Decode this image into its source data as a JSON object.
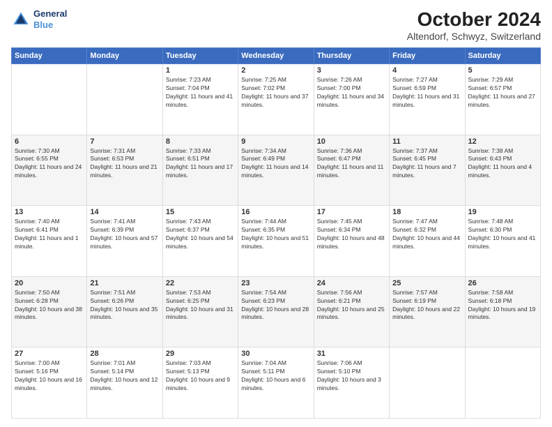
{
  "logo": {
    "line1": "General",
    "line2": "Blue"
  },
  "title": "October 2024",
  "subtitle": "Altendorf, Schwyz, Switzerland",
  "weekdays": [
    "Sunday",
    "Monday",
    "Tuesday",
    "Wednesday",
    "Thursday",
    "Friday",
    "Saturday"
  ],
  "weeks": [
    [
      {
        "day": "",
        "info": ""
      },
      {
        "day": "",
        "info": ""
      },
      {
        "day": "1",
        "info": "Sunrise: 7:23 AM\nSunset: 7:04 PM\nDaylight: 11 hours and 41 minutes."
      },
      {
        "day": "2",
        "info": "Sunrise: 7:25 AM\nSunset: 7:02 PM\nDaylight: 11 hours and 37 minutes."
      },
      {
        "day": "3",
        "info": "Sunrise: 7:26 AM\nSunset: 7:00 PM\nDaylight: 11 hours and 34 minutes."
      },
      {
        "day": "4",
        "info": "Sunrise: 7:27 AM\nSunset: 6:59 PM\nDaylight: 11 hours and 31 minutes."
      },
      {
        "day": "5",
        "info": "Sunrise: 7:29 AM\nSunset: 6:57 PM\nDaylight: 11 hours and 27 minutes."
      }
    ],
    [
      {
        "day": "6",
        "info": "Sunrise: 7:30 AM\nSunset: 6:55 PM\nDaylight: 11 hours and 24 minutes."
      },
      {
        "day": "7",
        "info": "Sunrise: 7:31 AM\nSunset: 6:53 PM\nDaylight: 11 hours and 21 minutes."
      },
      {
        "day": "8",
        "info": "Sunrise: 7:33 AM\nSunset: 6:51 PM\nDaylight: 11 hours and 17 minutes."
      },
      {
        "day": "9",
        "info": "Sunrise: 7:34 AM\nSunset: 6:49 PM\nDaylight: 11 hours and 14 minutes."
      },
      {
        "day": "10",
        "info": "Sunrise: 7:36 AM\nSunset: 6:47 PM\nDaylight: 11 hours and 11 minutes."
      },
      {
        "day": "11",
        "info": "Sunrise: 7:37 AM\nSunset: 6:45 PM\nDaylight: 11 hours and 7 minutes."
      },
      {
        "day": "12",
        "info": "Sunrise: 7:38 AM\nSunset: 6:43 PM\nDaylight: 11 hours and 4 minutes."
      }
    ],
    [
      {
        "day": "13",
        "info": "Sunrise: 7:40 AM\nSunset: 6:41 PM\nDaylight: 11 hours and 1 minute."
      },
      {
        "day": "14",
        "info": "Sunrise: 7:41 AM\nSunset: 6:39 PM\nDaylight: 10 hours and 57 minutes."
      },
      {
        "day": "15",
        "info": "Sunrise: 7:43 AM\nSunset: 6:37 PM\nDaylight: 10 hours and 54 minutes."
      },
      {
        "day": "16",
        "info": "Sunrise: 7:44 AM\nSunset: 6:35 PM\nDaylight: 10 hours and 51 minutes."
      },
      {
        "day": "17",
        "info": "Sunrise: 7:45 AM\nSunset: 6:34 PM\nDaylight: 10 hours and 48 minutes."
      },
      {
        "day": "18",
        "info": "Sunrise: 7:47 AM\nSunset: 6:32 PM\nDaylight: 10 hours and 44 minutes."
      },
      {
        "day": "19",
        "info": "Sunrise: 7:48 AM\nSunset: 6:30 PM\nDaylight: 10 hours and 41 minutes."
      }
    ],
    [
      {
        "day": "20",
        "info": "Sunrise: 7:50 AM\nSunset: 6:28 PM\nDaylight: 10 hours and 38 minutes."
      },
      {
        "day": "21",
        "info": "Sunrise: 7:51 AM\nSunset: 6:26 PM\nDaylight: 10 hours and 35 minutes."
      },
      {
        "day": "22",
        "info": "Sunrise: 7:53 AM\nSunset: 6:25 PM\nDaylight: 10 hours and 31 minutes."
      },
      {
        "day": "23",
        "info": "Sunrise: 7:54 AM\nSunset: 6:23 PM\nDaylight: 10 hours and 28 minutes."
      },
      {
        "day": "24",
        "info": "Sunrise: 7:56 AM\nSunset: 6:21 PM\nDaylight: 10 hours and 25 minutes."
      },
      {
        "day": "25",
        "info": "Sunrise: 7:57 AM\nSunset: 6:19 PM\nDaylight: 10 hours and 22 minutes."
      },
      {
        "day": "26",
        "info": "Sunrise: 7:58 AM\nSunset: 6:18 PM\nDaylight: 10 hours and 19 minutes."
      }
    ],
    [
      {
        "day": "27",
        "info": "Sunrise: 7:00 AM\nSunset: 5:16 PM\nDaylight: 10 hours and 16 minutes."
      },
      {
        "day": "28",
        "info": "Sunrise: 7:01 AM\nSunset: 5:14 PM\nDaylight: 10 hours and 12 minutes."
      },
      {
        "day": "29",
        "info": "Sunrise: 7:03 AM\nSunset: 5:13 PM\nDaylight: 10 hours and 9 minutes."
      },
      {
        "day": "30",
        "info": "Sunrise: 7:04 AM\nSunset: 5:11 PM\nDaylight: 10 hours and 6 minutes."
      },
      {
        "day": "31",
        "info": "Sunrise: 7:06 AM\nSunset: 5:10 PM\nDaylight: 10 hours and 3 minutes."
      },
      {
        "day": "",
        "info": ""
      },
      {
        "day": "",
        "info": ""
      }
    ]
  ]
}
